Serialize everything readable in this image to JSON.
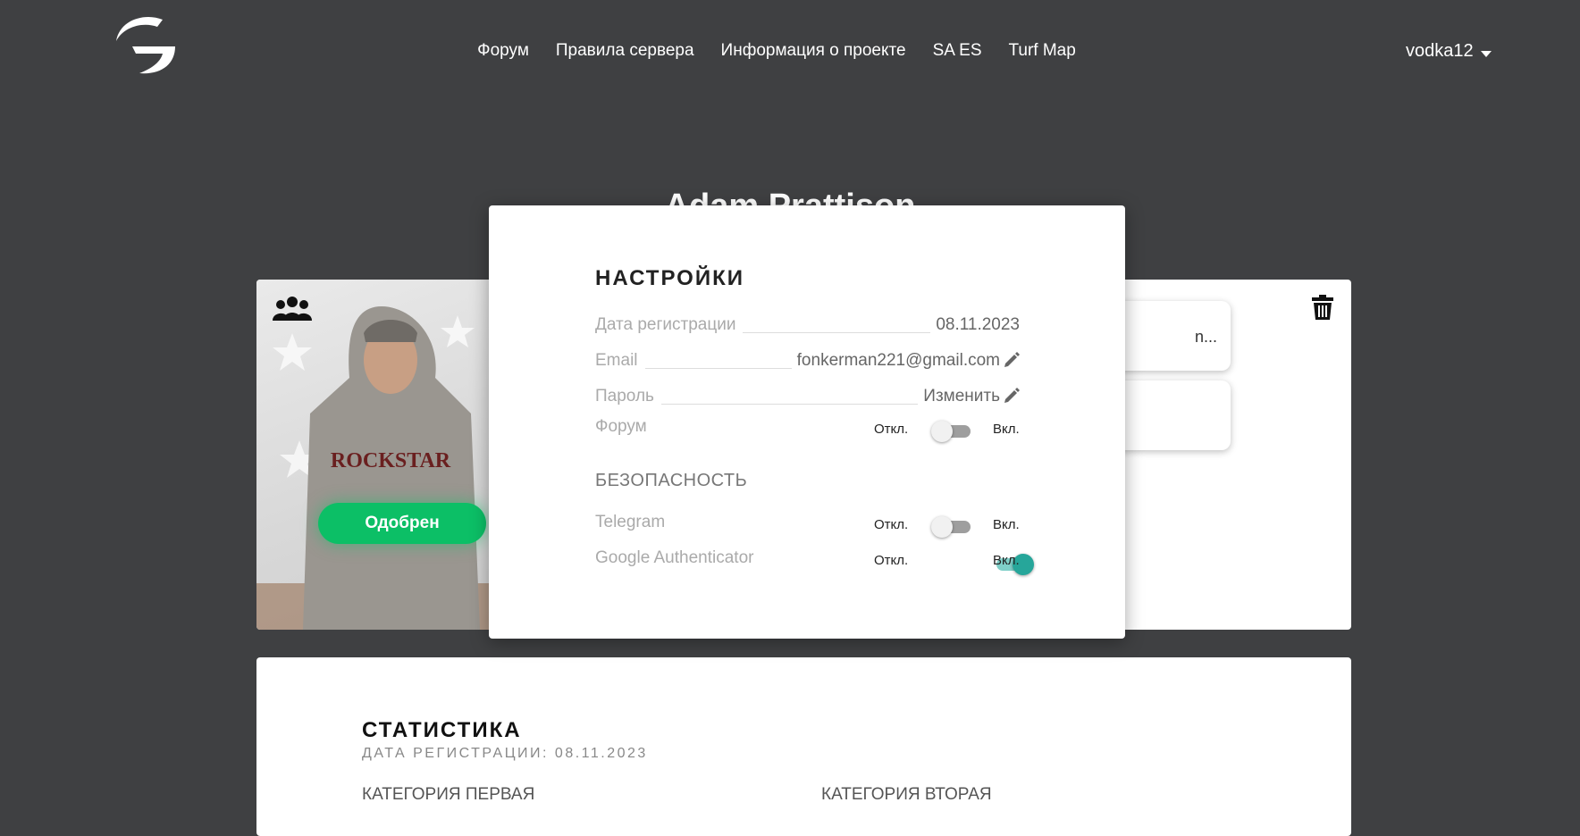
{
  "header": {
    "logo_icon": "g-logo-icon",
    "nav": [
      "Форум",
      "Правила сервера",
      "Информация о проекте",
      "SA ES",
      "Turf Map"
    ],
    "username": "vodka12"
  },
  "profile": {
    "name": "Adam Prattison",
    "status_button": "Одобрен",
    "side_box_1_text": "n...",
    "colors": {
      "approved": "#0cbf66",
      "toggle_on": "#26a69a"
    }
  },
  "settings": {
    "title": "НАСТРОЙКИ",
    "reg_date_label": "Дата регистрации",
    "reg_date_value": "08.11.2023",
    "email_label": "Email",
    "email_value": "fonkerman221@gmail.com",
    "password_label": "Пароль",
    "password_value": "Изменить",
    "forum_label": "Форум",
    "off_label": "Откл.",
    "on_label": "Вкл.",
    "security_title": "БЕЗОПАСНОСТЬ",
    "telegram_label": "Telegram",
    "google_auth_label": "Google Authenticator",
    "toggles": {
      "forum": false,
      "telegram": false,
      "google_authenticator": true
    }
  },
  "stats": {
    "title": "СТАТИСТИКА",
    "subtitle": "ДАТА РЕГИСТРАЦИИ: 08.11.2023",
    "category_1": "КАТЕГОРИЯ ПЕРВАЯ",
    "category_2": "КАТЕГОРИЯ ВТОРАЯ"
  }
}
